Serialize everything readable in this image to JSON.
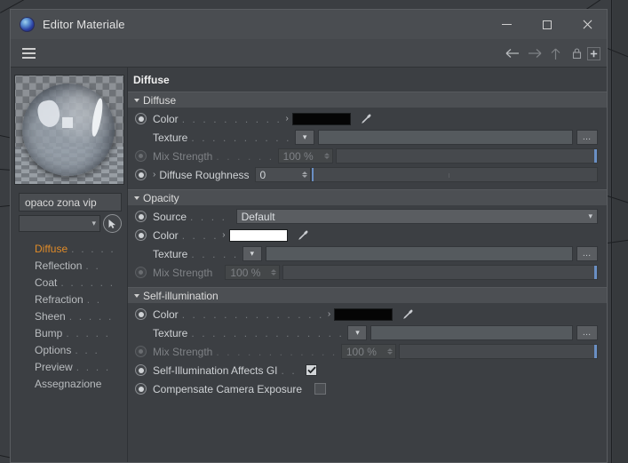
{
  "window": {
    "title": "Editor Materiale",
    "app_icon": "material-sphere-icon",
    "minimize_label": "—",
    "maximize_label": "☐",
    "close_label": "✕"
  },
  "toolbar": {
    "menu_icon": "hamburger-menu-icon",
    "back_icon": "arrow-left-icon",
    "forward_icon": "arrow-right-icon",
    "up_icon": "arrow-up-icon",
    "lock_icon": "lock-icon",
    "pin_icon": "plus-square-icon"
  },
  "sidebar": {
    "preview_name": "material-preview-sphere",
    "material_name": "opaco zona vip",
    "layer_select_value": "",
    "picker_icon": "cursor-arrow-icon",
    "channels": [
      {
        "label": "Diffuse",
        "dots": ". . . . .",
        "active": true
      },
      {
        "label": "Reflection",
        "dots": ". .",
        "active": false
      },
      {
        "label": "Coat",
        "dots": ". . . . . .",
        "active": false
      },
      {
        "label": "Refraction",
        "dots": ". .",
        "active": false
      },
      {
        "label": "Sheen",
        "dots": ". . . . .",
        "active": false
      },
      {
        "label": "Bump",
        "dots": ". . . . .",
        "active": false
      },
      {
        "label": "Options",
        "dots": ". . .",
        "active": false
      },
      {
        "label": "Preview",
        "dots": ". . . .",
        "active": false
      },
      {
        "label": "Assegnazione",
        "dots": "",
        "active": false
      }
    ]
  },
  "main": {
    "page_title": "Diffuse",
    "groups": {
      "diffuse": {
        "header": "Diffuse",
        "color": {
          "label": "Color",
          "dots": ". . . . . . . . . .",
          "arrow": "›",
          "swatch_hex": "#050505",
          "dropper_icon": "eyedropper-icon"
        },
        "texture": {
          "label": "Texture",
          "dots": ". . . . . . . . . .",
          "value": "",
          "combo_icon": "chevron-down-icon",
          "browse_label": "…"
        },
        "mix_strength": {
          "label": "Mix Strength",
          "dots": ". . . . . .",
          "value": "100 %",
          "enabled": false
        },
        "roughness": {
          "label": "Diffuse Roughness",
          "arrow": "›",
          "value": "0"
        }
      },
      "opacity": {
        "header": "Opacity",
        "source": {
          "label": "Source",
          "dots": ". . . .",
          "value": "Default",
          "combo_icon": "chevron-down-icon"
        },
        "color": {
          "label": "Color",
          "dots": ". . . .",
          "arrow": "›",
          "swatch_hex": "#ffffff",
          "dropper_icon": "eyedropper-icon"
        },
        "texture": {
          "label": "Texture",
          "dots": ". . . . .",
          "value": "",
          "combo_icon": "chevron-down-icon",
          "browse_label": "…"
        },
        "mix_strength": {
          "label": "Mix Strength",
          "dots": "",
          "value": "100 %",
          "enabled": false
        }
      },
      "self_illumination": {
        "header": "Self-illumination",
        "color": {
          "label": "Color",
          "dots": ". . . . . . . . . . . . . .",
          "arrow": "›",
          "swatch_hex": "#050505",
          "dropper_icon": "eyedropper-icon"
        },
        "texture": {
          "label": "Texture",
          "dots": ". . . . . . . . . . . . . . .",
          "value": "",
          "combo_icon": "chevron-down-icon",
          "browse_label": "…"
        },
        "mix_strength": {
          "label": "Mix Strength",
          "dots": ". . . . . . . . . . . .",
          "value": "100 %",
          "enabled": false
        },
        "affects_gi": {
          "label": "Self-Illumination Affects GI",
          "dots": ". .",
          "checked": true
        },
        "compensate_exposure": {
          "label": "Compensate Camera Exposure",
          "dots": "",
          "checked": false
        }
      }
    }
  },
  "colors": {
    "window_bg": "#3c3f43",
    "titlebar_bg": "#4a4d51",
    "group_header_bg": "#4c4f53",
    "accent_active": "#e08b28",
    "slider_marker": "#6a8fc4"
  }
}
